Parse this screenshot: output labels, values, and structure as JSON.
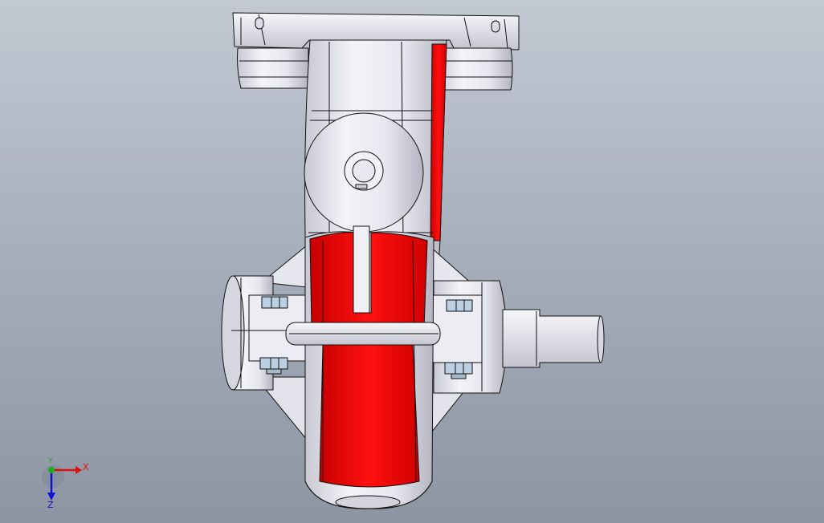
{
  "viewport": {
    "background_top": "#c3c9d3",
    "background_bottom": "#8d95a3"
  },
  "model": {
    "body_color": "#eeeef4",
    "tire_color": "#ff0000",
    "edge_color": "#111111",
    "bolt_color": "#bcd0e4"
  },
  "triad": {
    "x_label": "X",
    "y_label": "Y",
    "z_label": "Z",
    "x_color": "#e01010",
    "y_color": "#22aa22",
    "z_color": "#1010d0"
  }
}
